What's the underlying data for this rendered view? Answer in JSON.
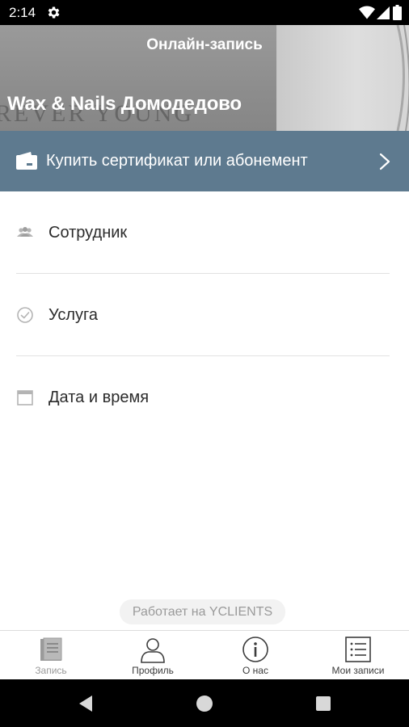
{
  "status_bar": {
    "time": "2:14",
    "icons": [
      "gear-icon",
      "wifi-icon",
      "signal-icon",
      "battery-icon"
    ]
  },
  "header": {
    "title": "Онлайн-запись",
    "salon_name": "Wax & Nails Домодедово",
    "background_text": "REVER YOUNG"
  },
  "certificate": {
    "label": "Купить сертификат или абонемент",
    "icon": "wallet-icon",
    "background_color": "#5e7a8f"
  },
  "steps": [
    {
      "label": "Сотрудник",
      "icon": "people-icon"
    },
    {
      "label": "Услуга",
      "icon": "check-circle-icon"
    },
    {
      "label": "Дата и время",
      "icon": "calendar-icon"
    }
  ],
  "powered_by": "Работает на YCLIENTS",
  "tabs": [
    {
      "label": "Запись",
      "icon": "book-icon",
      "active": false
    },
    {
      "label": "Профиль",
      "icon": "person-icon",
      "active": true
    },
    {
      "label": "О нас",
      "icon": "info-icon",
      "active": true
    },
    {
      "label": "Мои записи",
      "icon": "list-icon",
      "active": true
    }
  ],
  "nav_bar": [
    "back-icon",
    "home-icon",
    "recents-icon"
  ]
}
